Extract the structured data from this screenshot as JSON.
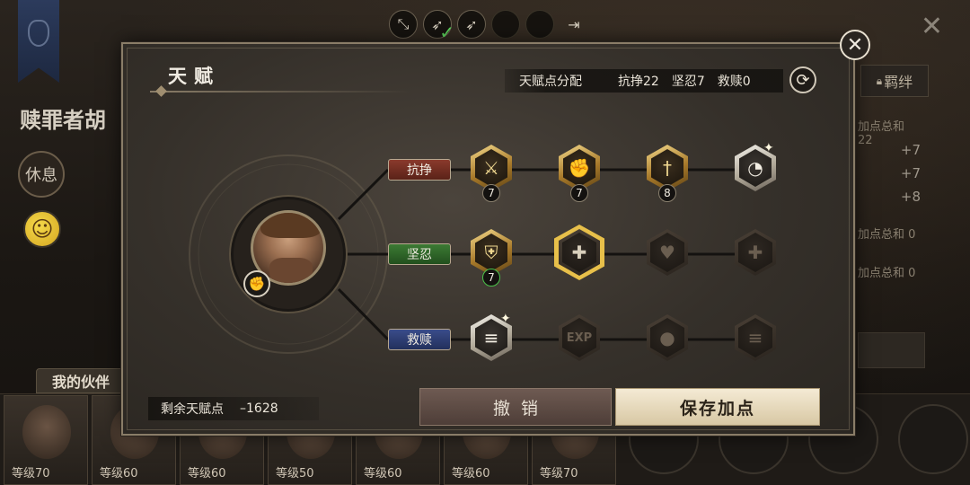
{
  "background": {
    "hero_name": "赎罪者胡",
    "rest_button": "休息",
    "bond_tab": "羁绊",
    "stats": [
      {
        "label": "加点总和 22",
        "values": [
          "+7",
          "+7",
          "+8"
        ]
      },
      {
        "label": "加点总和 0"
      },
      {
        "label": "加点总和 0"
      }
    ],
    "partners_tab": "我的伙伴",
    "partner_levels": [
      "等级70",
      "等级60",
      "等级60",
      "等级50",
      "等级60",
      "等级60",
      "等级70"
    ]
  },
  "top_tabs": {
    "icons": [
      "expand-arrows-icon",
      "bow-icon",
      "bow-icon",
      "empty-slot",
      "empty-slot",
      "exit-door-icon"
    ]
  },
  "dialog": {
    "title": "天赋",
    "allocation_label": "天赋点分配",
    "stat_resist": "抗挣22",
    "stat_endure": "坚忍7",
    "stat_redeem": "救赎0",
    "close_icon": "close-icon",
    "reset_icon": "refresh-icon"
  },
  "tree": {
    "branches": [
      {
        "label": "抗挣",
        "color": "#8a3a2c",
        "nodes": [
          {
            "state": "gold",
            "icon": "sword-icon",
            "count": "7"
          },
          {
            "state": "gold",
            "icon": "fist-icon",
            "count": "7"
          },
          {
            "state": "gold",
            "icon": "dagger-icon",
            "count": "8"
          },
          {
            "state": "silver",
            "icon": "meter-icon",
            "count": ""
          }
        ]
      },
      {
        "label": "坚忍",
        "color": "#3c7a34",
        "nodes": [
          {
            "state": "gold",
            "icon": "armor-icon",
            "count": "7"
          },
          {
            "state": "selected",
            "icon": "broken-heal-icon",
            "count": ""
          },
          {
            "state": "dark",
            "icon": "heart-icon",
            "count": ""
          },
          {
            "state": "dark",
            "icon": "broken-heal-icon",
            "count": ""
          }
        ]
      },
      {
        "label": "救赎",
        "color": "#3a4c8a",
        "nodes": [
          {
            "state": "silver",
            "icon": "steps-icon",
            "count": ""
          },
          {
            "state": "dark",
            "icon": "exp-icon",
            "count": ""
          },
          {
            "state": "dark",
            "icon": "money-bag-icon",
            "count": ""
          },
          {
            "state": "dark",
            "icon": "steps-icon",
            "count": ""
          }
        ]
      }
    ]
  },
  "footer": {
    "remaining_label": "剩余天赋点",
    "remaining_value": "–1628",
    "cancel_label": "撤销",
    "save_label": "保存加点"
  }
}
